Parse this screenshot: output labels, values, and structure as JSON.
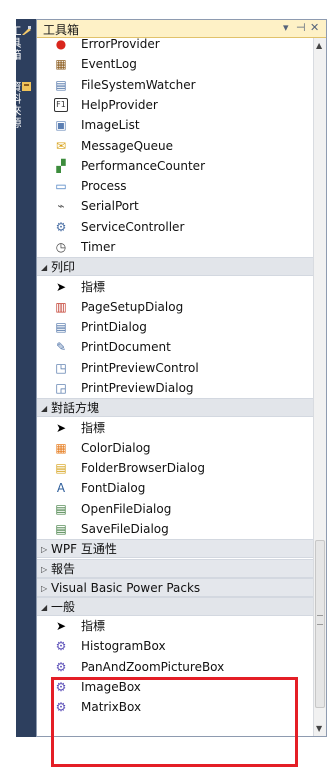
{
  "sidebar": {
    "tabs": [
      {
        "label": "工具箱",
        "icon": "toolbox-icon"
      },
      {
        "label": "資料來源",
        "icon": "data-sources-icon"
      }
    ]
  },
  "toolbox": {
    "title": "工具箱",
    "controls": {
      "dropdown": "▾",
      "pin": "⊣",
      "close": "✕"
    },
    "items_top": [
      {
        "label": "ErrorProvider",
        "icon": "error-provider-icon",
        "glyph": "●",
        "color": "#d9261c"
      },
      {
        "label": "EventLog",
        "icon": "event-log-icon",
        "glyph": "▦",
        "color": "#8a5a1c"
      },
      {
        "label": "FileSystemWatcher",
        "icon": "file-system-watcher-icon",
        "glyph": "▤",
        "color": "#4a6fa5"
      },
      {
        "label": "HelpProvider",
        "icon": "help-provider-icon",
        "glyph": "F1",
        "color": "#333333"
      },
      {
        "label": "ImageList",
        "icon": "image-list-icon",
        "glyph": "▣",
        "color": "#5b7fb3"
      },
      {
        "label": "MessageQueue",
        "icon": "message-queue-icon",
        "glyph": "✉",
        "color": "#d8a21a"
      },
      {
        "label": "PerformanceCounter",
        "icon": "performance-counter-icon",
        "glyph": "▞",
        "color": "#3c8c3c"
      },
      {
        "label": "Process",
        "icon": "process-icon",
        "glyph": "▭",
        "color": "#4a7fc1"
      },
      {
        "label": "SerialPort",
        "icon": "serial-port-icon",
        "glyph": "⌁",
        "color": "#555555"
      },
      {
        "label": "ServiceController",
        "icon": "service-controller-icon",
        "glyph": "⚙",
        "color": "#4a6fa5"
      },
      {
        "label": "Timer",
        "icon": "timer-icon",
        "glyph": "◷",
        "color": "#444444"
      }
    ],
    "categories": [
      {
        "label": "列印",
        "expanded": true,
        "items": [
          {
            "label": "指標",
            "icon": "pointer-icon",
            "glyph": "➤",
            "color": "#000000"
          },
          {
            "label": "PageSetupDialog",
            "icon": "page-setup-dialog-icon",
            "glyph": "▥",
            "color": "#c0392b"
          },
          {
            "label": "PrintDialog",
            "icon": "print-dialog-icon",
            "glyph": "▤",
            "color": "#4a6fa5"
          },
          {
            "label": "PrintDocument",
            "icon": "print-document-icon",
            "glyph": "✎",
            "color": "#4a6fa5"
          },
          {
            "label": "PrintPreviewControl",
            "icon": "print-preview-control-icon",
            "glyph": "◳",
            "color": "#4a6fa5"
          },
          {
            "label": "PrintPreviewDialog",
            "icon": "print-preview-dialog-icon",
            "glyph": "◲",
            "color": "#4a6fa5"
          }
        ]
      },
      {
        "label": "對話方塊",
        "expanded": true,
        "items": [
          {
            "label": "指標",
            "icon": "pointer-icon",
            "glyph": "➤",
            "color": "#000000"
          },
          {
            "label": "ColorDialog",
            "icon": "color-dialog-icon",
            "glyph": "▦",
            "color": "#e67e22"
          },
          {
            "label": "FolderBrowserDialog",
            "icon": "folder-browser-dialog-icon",
            "glyph": "▤",
            "color": "#d4a017"
          },
          {
            "label": "FontDialog",
            "icon": "font-dialog-icon",
            "glyph": "A",
            "color": "#2c5c9a"
          },
          {
            "label": "OpenFileDialog",
            "icon": "open-file-dialog-icon",
            "glyph": "▤",
            "color": "#3c7a3c"
          },
          {
            "label": "SaveFileDialog",
            "icon": "save-file-dialog-icon",
            "glyph": "▤",
            "color": "#3c7a3c"
          }
        ]
      },
      {
        "label": "WPF 互通性",
        "expanded": false,
        "items": []
      },
      {
        "label": "報告",
        "expanded": false,
        "items": []
      },
      {
        "label": "Visual Basic Power Packs",
        "expanded": false,
        "items": []
      },
      {
        "label": "一般",
        "expanded": true,
        "items": [
          {
            "label": "指標",
            "icon": "pointer-icon",
            "glyph": "➤",
            "color": "#000000"
          },
          {
            "label": "HistogramBox",
            "icon": "gear-component-icon",
            "glyph": "⚙",
            "color": "#5b4fb8"
          },
          {
            "label": "PanAndZoomPictureBox",
            "icon": "gear-component-icon",
            "glyph": "⚙",
            "color": "#5b4fb8"
          },
          {
            "label": "ImageBox",
            "icon": "gear-component-icon",
            "glyph": "⚙",
            "color": "#5b4fb8"
          },
          {
            "label": "MatrixBox",
            "icon": "gear-component-icon",
            "glyph": "⚙",
            "color": "#5b4fb8"
          }
        ]
      }
    ]
  },
  "colors": {
    "highlight_border": "#e41e26",
    "title_bar": "#fef1c6",
    "sidebar": "#2d3f5e"
  }
}
